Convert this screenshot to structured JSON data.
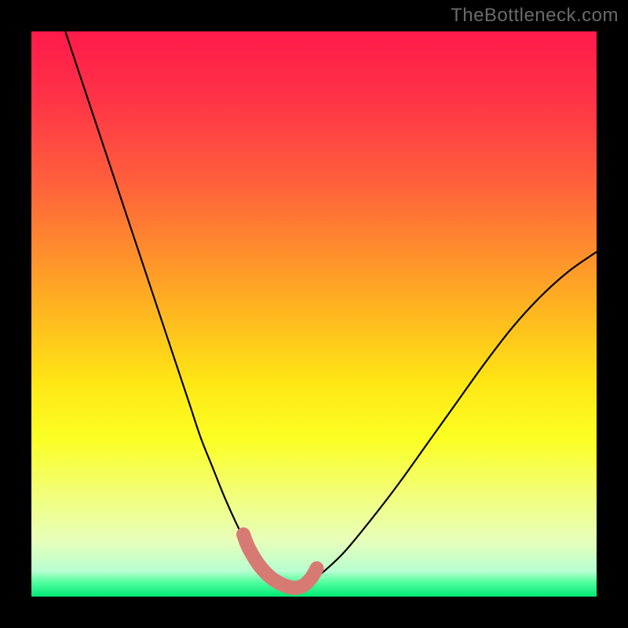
{
  "watermark": "TheBottleneck.com",
  "chart_data": {
    "type": "line",
    "title": "",
    "xlabel": "",
    "ylabel": "",
    "xlim": [
      0,
      100
    ],
    "ylim": [
      0,
      100
    ],
    "gradient_stops": [
      {
        "offset": 0.0,
        "color": "#ff1a4a"
      },
      {
        "offset": 0.12,
        "color": "#ff3347"
      },
      {
        "offset": 0.25,
        "color": "#ff5a3d"
      },
      {
        "offset": 0.38,
        "color": "#ff8a2e"
      },
      {
        "offset": 0.5,
        "color": "#ffb81f"
      },
      {
        "offset": 0.62,
        "color": "#ffe615"
      },
      {
        "offset": 0.72,
        "color": "#fbff22"
      },
      {
        "offset": 0.82,
        "color": "#f2ff7a"
      },
      {
        "offset": 0.9,
        "color": "#e8ffba"
      },
      {
        "offset": 0.955,
        "color": "#b8ffd0"
      },
      {
        "offset": 0.975,
        "color": "#50ff9e"
      },
      {
        "offset": 1.0,
        "color": "#00e876"
      }
    ],
    "series": [
      {
        "name": "bottleneck-curve",
        "color": "#000000",
        "thickness": 2.2,
        "x": [
          6,
          8,
          10,
          12,
          14,
          16,
          18,
          20,
          22,
          24,
          26,
          28,
          30,
          32,
          34,
          36,
          38,
          40,
          42,
          44,
          46,
          48,
          50,
          55,
          60,
          65,
          70,
          75,
          80,
          85,
          90,
          95,
          100
        ],
        "y": [
          100,
          94,
          88,
          82,
          76,
          70,
          64,
          58,
          52,
          46,
          40,
          34,
          28,
          23,
          18,
          13.5,
          9.5,
          6.2,
          3.8,
          2.2,
          1.5,
          1.8,
          3.0,
          7.5,
          13.5,
          20,
          27,
          34,
          41,
          47.5,
          53,
          57.5,
          61
        ]
      },
      {
        "name": "highlight-region",
        "color": "#d87a74",
        "thickness": 18,
        "linecap": "round",
        "x": [
          37.5,
          38.5,
          40.5,
          43,
          46,
          48,
          49.5,
          50.5
        ],
        "y": [
          11,
          8.5,
          5.3,
          2.9,
          1.6,
          1.9,
          3.3,
          5.0
        ]
      }
    ]
  }
}
